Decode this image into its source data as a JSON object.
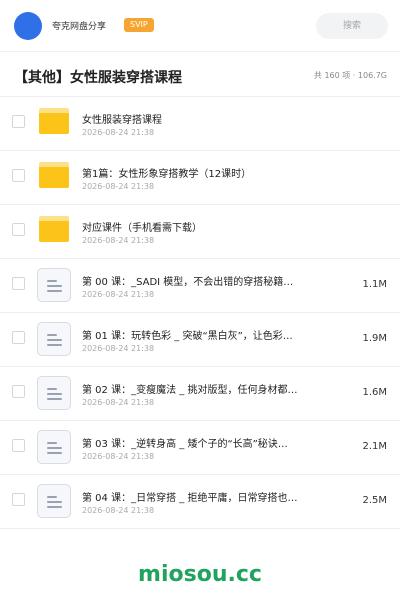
{
  "header": {
    "site_name": "夸克网盘分享",
    "badge": "SVIP",
    "search_placeholder": "搜索",
    "colors": {
      "avatar": "#2f6fe8",
      "badge": "#f6a532"
    }
  },
  "folder": {
    "title": "【其他】女性服装穿搭课程",
    "summary": "共 160 项 · 106.7G"
  },
  "items": [
    {
      "type": "folder",
      "name": "女性服装穿搭课程",
      "date": "2026-08-24 21:38",
      "size": ""
    },
    {
      "type": "folder",
      "name": "第1篇：女性形象穿搭教学（12课时）",
      "date": "2026-08-24 21:38",
      "size": ""
    },
    {
      "type": "folder",
      "name": "对应课件（手机看需下载）",
      "date": "2026-08-24 21:38",
      "size": ""
    },
    {
      "type": "file",
      "name": "第 00 课：_SADI 模型，不会出错的穿搭秘籍…",
      "date": "2026-08-24 21:38",
      "size": "1.1M"
    },
    {
      "type": "file",
      "name": "第 01 课：玩转色彩 _ 突破“黑白灰”，让色彩…",
      "date": "2026-08-24 21:38",
      "size": "1.9M"
    },
    {
      "type": "file",
      "name": "第 02 课：_变瘦魔法 _ 挑对版型，任何身材都…",
      "date": "2026-08-24 21:38",
      "size": "1.6M"
    },
    {
      "type": "file",
      "name": "第 03 课：_逆转身高 _ 矮个子的“长高”秘诀…",
      "date": "2026-08-24 21:38",
      "size": "2.1M"
    },
    {
      "type": "file",
      "name": "第 04 课：_日常穿搭 _ 拒绝平庸，日常穿搭也…",
      "date": "2026-08-24 21:38",
      "size": "2.5M"
    }
  ],
  "watermark": "miosou.cc"
}
